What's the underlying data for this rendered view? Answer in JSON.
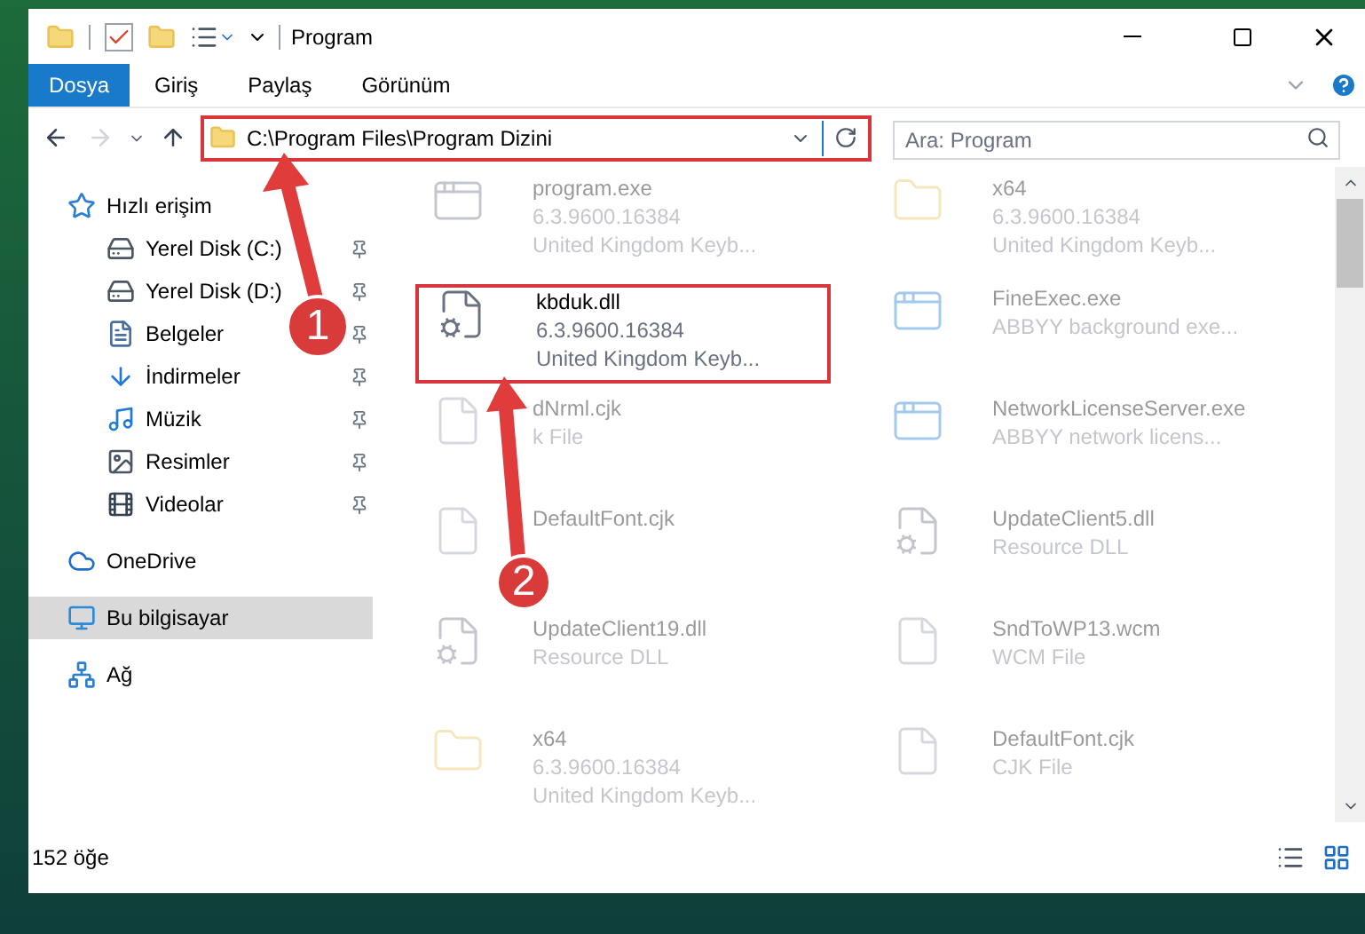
{
  "window": {
    "title": "Program"
  },
  "ribbon_tabs": [
    {
      "label": "Dosya",
      "selected": true
    },
    {
      "label": "Giriş",
      "selected": false
    },
    {
      "label": "Paylaş",
      "selected": false
    },
    {
      "label": "Görünüm",
      "selected": false
    }
  ],
  "address_bar": {
    "path": "C:\\Program Files\\Program Dizini",
    "highlighted": true
  },
  "search": {
    "placeholder": "Ara: Program"
  },
  "sidebar": {
    "items": [
      {
        "label": "Hızlı erişim",
        "kind": "star",
        "selected": false,
        "children": [
          {
            "label": "Yerel Disk (C:)",
            "kind": "drive",
            "selected": false,
            "pinned": true
          },
          {
            "label": "Yerel Disk (D:)",
            "kind": "drive",
            "selected": false,
            "pinned": true
          },
          {
            "label": "Belgeler",
            "kind": "document",
            "selected": false,
            "pinned": true
          },
          {
            "label": "İndirmeler",
            "kind": "download",
            "selected": false,
            "pinned": true
          },
          {
            "label": "Müzik",
            "kind": "music",
            "selected": false,
            "pinned": true
          },
          {
            "label": "Resimler",
            "kind": "pictures",
            "selected": false,
            "pinned": true
          },
          {
            "label": "Videolar",
            "kind": "videos",
            "selected": false,
            "pinned": true
          }
        ]
      },
      {
        "label": "OneDrive",
        "kind": "cloud",
        "selected": false
      },
      {
        "label": "Bu bilgisayar",
        "kind": "computer",
        "selected": true
      },
      {
        "label": "Ağ",
        "kind": "network",
        "selected": false
      }
    ]
  },
  "files": [
    {
      "name": "program.exe",
      "details": [
        "6.3.9600.16384",
        "United Kingdom Keyb..."
      ],
      "kind": "exe",
      "highlighted": false,
      "blurred": true
    },
    {
      "name": "x64",
      "details": [
        "6.3.9600.16384",
        "United Kingdom Keyb..."
      ],
      "kind": "folder",
      "highlighted": false,
      "blurred": true
    },
    {
      "name": "kbduk.dll",
      "details": [
        "6.3.9600.16384",
        "United Kingdom Keyb..."
      ],
      "kind": "dll",
      "highlighted": true,
      "blurred": false
    },
    {
      "name": "FineExec.exe",
      "details": [
        "ABBYY background exe..."
      ],
      "kind": "app",
      "highlighted": false,
      "blurred": true
    },
    {
      "name": "dNrml.cjk",
      "details": [
        "k File"
      ],
      "kind": "file",
      "highlighted": false,
      "blurred": true
    },
    {
      "name": "NetworkLicenseServer.exe",
      "details": [
        "ABBYY network licens..."
      ],
      "kind": "app",
      "highlighted": false,
      "blurred": true
    },
    {
      "name": "DefaultFont.cjk",
      "kind": "file",
      "highlighted": false,
      "blurred": true
    },
    {
      "name": "UpdateClient5.dll",
      "details": [
        "Resource DLL"
      ],
      "kind": "dll",
      "highlighted": false,
      "blurred": true
    },
    {
      "name": "UpdateClient19.dll",
      "details": [
        "Resource DLL"
      ],
      "kind": "dll",
      "highlighted": false,
      "blurred": true
    },
    {
      "name": "SndToWP13.wcm",
      "details": [
        "WCM File"
      ],
      "kind": "file",
      "highlighted": false,
      "blurred": true
    },
    {
      "name": "x64",
      "details": [
        "6.3.9600.16384",
        "United Kingdom Keyb..."
      ],
      "kind": "folder",
      "highlighted": false,
      "blurred": true
    },
    {
      "name": "DefaultFont.cjk",
      "details": [
        "CJK File"
      ],
      "kind": "file",
      "highlighted": false,
      "blurred": true
    }
  ],
  "status_bar": {
    "item_count": "152 öğe"
  },
  "callouts": [
    {
      "number": "1"
    },
    {
      "number": "2"
    }
  ]
}
